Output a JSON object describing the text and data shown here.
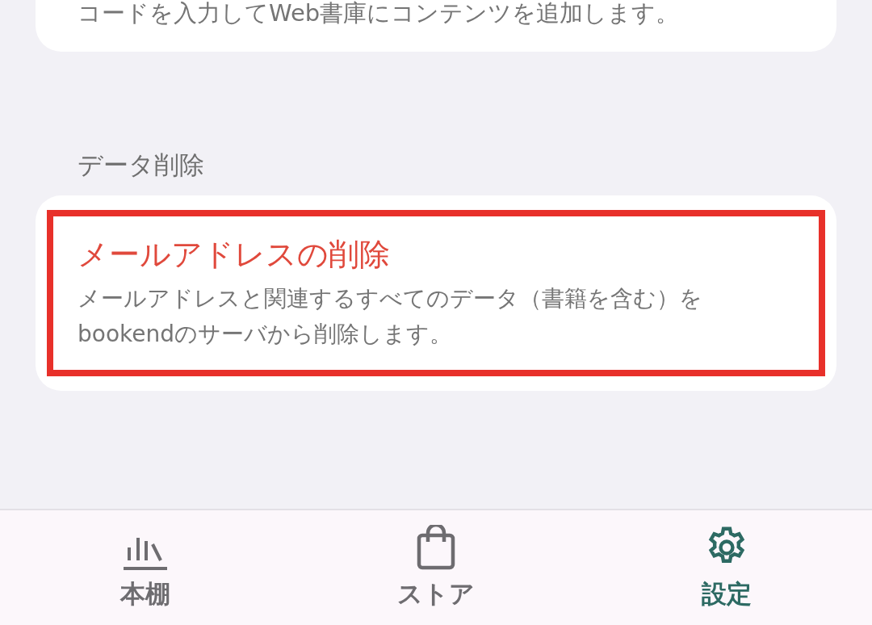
{
  "top_card": {
    "description": "コードを入力してWeb書庫にコンテンツを追加します。"
  },
  "section": {
    "heading": "データ削除",
    "item": {
      "title": "メールアドレスの削除",
      "description": "メールアドレスと関連するすべてのデータ（書籍を含む）をbookendのサーバから削除します。",
      "highlighted": true
    }
  },
  "bottom_nav": [
    {
      "kind": "shelf",
      "label": "本棚",
      "selected": false
    },
    {
      "kind": "store",
      "label": "ストア",
      "selected": false
    },
    {
      "kind": "settings",
      "label": "設定",
      "selected": true
    }
  ]
}
